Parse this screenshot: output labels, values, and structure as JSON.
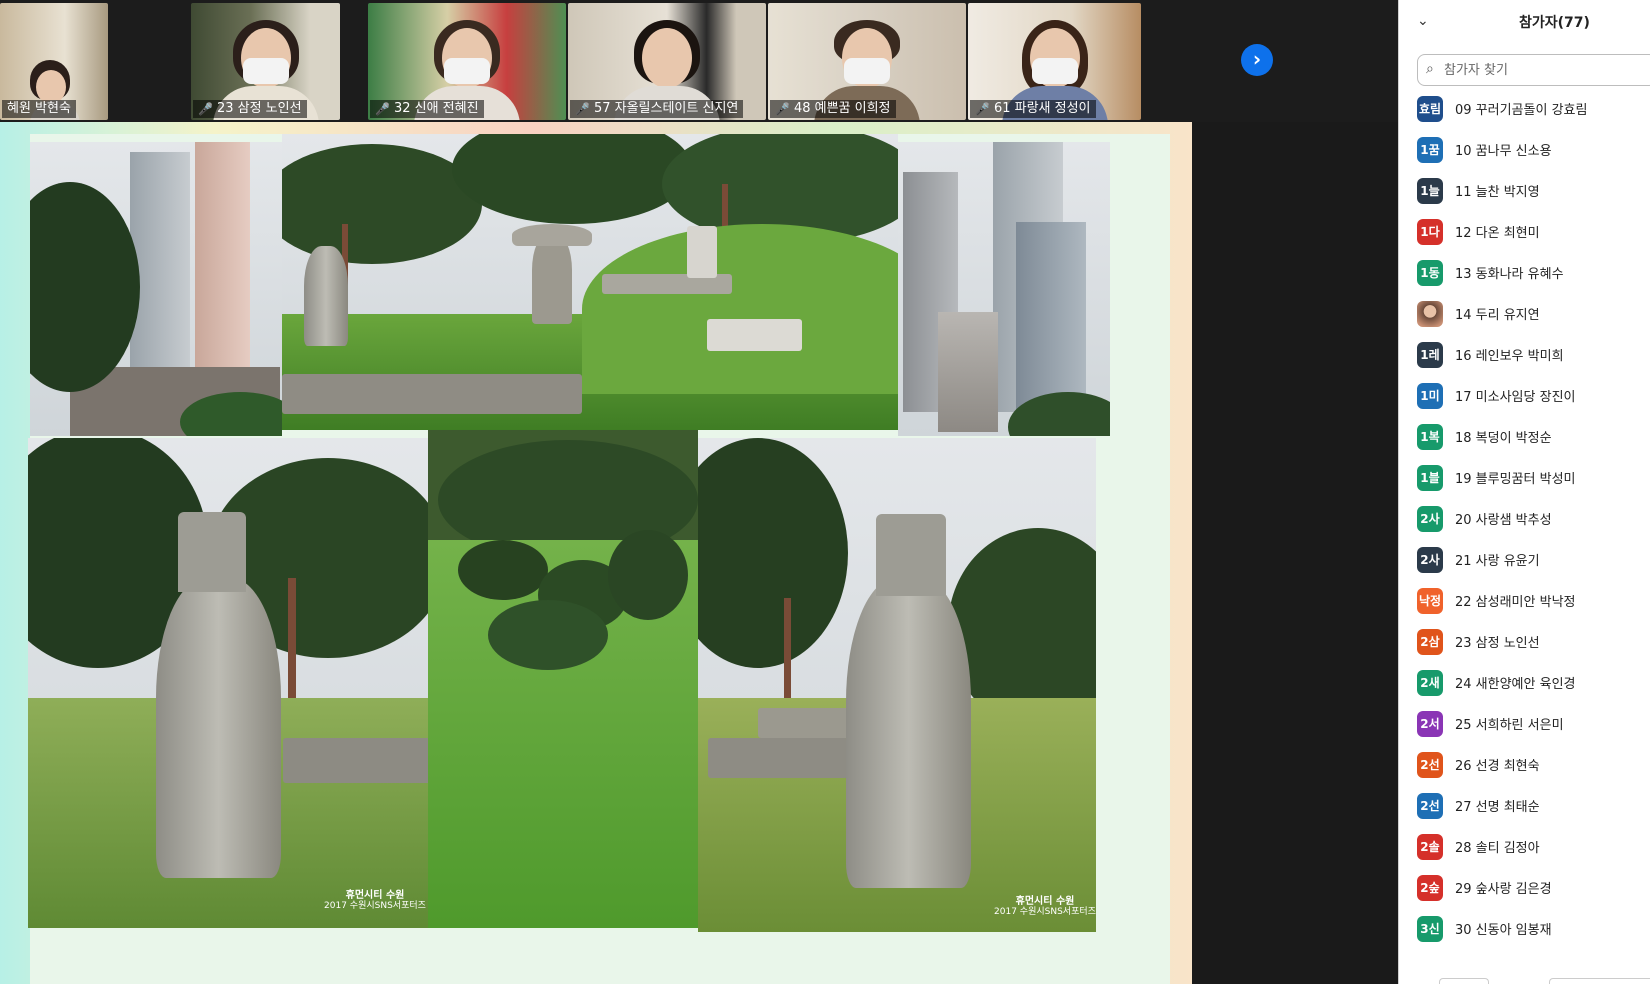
{
  "thumbnails": [
    {
      "label": "혜원 박현숙",
      "muted": false,
      "bg": "#c9b99d"
    },
    {
      "label": "23 삼정 노인선",
      "muted": true,
      "bg": "#6a6f55"
    },
    {
      "label": "32 신애 전혜진",
      "muted": true,
      "bg": "#4f8f53"
    },
    {
      "label": "57 자올릴스테이트 신지연",
      "muted": true,
      "bg": "#cfc7b8"
    },
    {
      "label": "48 예쁜꿈 이희정",
      "muted": true,
      "bg": "#d8d0c3"
    },
    {
      "label": "61 파랑새 정성이",
      "muted": true,
      "bg": "#e2d7c5"
    }
  ],
  "next_icon": "chevron-right-icon",
  "next_glyph": "›",
  "panel": {
    "collapse_glyph": "⌄",
    "title": "참가자(77)",
    "search_placeholder": "참가자 찾기",
    "search_icon": "search-icon"
  },
  "participants": [
    {
      "badge": "효림",
      "color": "#1f4e8c",
      "name": "09 꾸러기곰돌이 강효림"
    },
    {
      "badge": "1꿈",
      "color": "#1e6fb5",
      "name": "10 꿈나무 신소용"
    },
    {
      "badge": "1늘",
      "color": "#2b3a4a",
      "name": "11 늘찬 박지영"
    },
    {
      "badge": "1다",
      "color": "#d5302a",
      "name": "12 다온 최현미"
    },
    {
      "badge": "1동",
      "color": "#179a6b",
      "name": "13 동화나라  유혜수"
    },
    {
      "badge": "",
      "color": "photo",
      "name": "14 두리 유지연"
    },
    {
      "badge": "1레",
      "color": "#2b3a4a",
      "name": "16 레인보우 박미희"
    },
    {
      "badge": "1미",
      "color": "#1e6fb5",
      "name": "17 미소사임당 장진이"
    },
    {
      "badge": "1복",
      "color": "#179a6b",
      "name": "18 복덩이 박정순"
    },
    {
      "badge": "1블",
      "color": "#179a6b",
      "name": "19 블루밍꿈터 박성미"
    },
    {
      "badge": "2사",
      "color": "#179a6b",
      "name": "20 사랑샘 박추성"
    },
    {
      "badge": "2사",
      "color": "#2b3a4a",
      "name": "21 사랑 유윤기"
    },
    {
      "badge": "낙정",
      "color": "#f0622b",
      "name": "22 삼성래미안 박낙정"
    },
    {
      "badge": "2삼",
      "color": "#e0541b",
      "name": "23 삼정 노인선"
    },
    {
      "badge": "2새",
      "color": "#179a6b",
      "name": "24 새한양예안 육인경"
    },
    {
      "badge": "2서",
      "color": "#8a35b5",
      "name": "25 서희하린 서은미"
    },
    {
      "badge": "2선",
      "color": "#e0541b",
      "name": "26 선경 최현숙"
    },
    {
      "badge": "2선",
      "color": "#1e6fb5",
      "name": "27 선명 최태순"
    },
    {
      "badge": "2솔",
      "color": "#d5302a",
      "name": "28 솔티 김정아"
    },
    {
      "badge": "2숲",
      "color": "#d5302a",
      "name": "29 숲사랑 김은경"
    },
    {
      "badge": "3신",
      "color": "#179a6b",
      "name": "30 신동아  임봉재"
    }
  ],
  "watermarks": [
    {
      "main": "휴먼시티 수원",
      "sub": "2017 수원시SNS서포터즈"
    },
    {
      "main": "휴먼시티 수원",
      "sub": "2017 수원시SNS서포터즈"
    }
  ]
}
